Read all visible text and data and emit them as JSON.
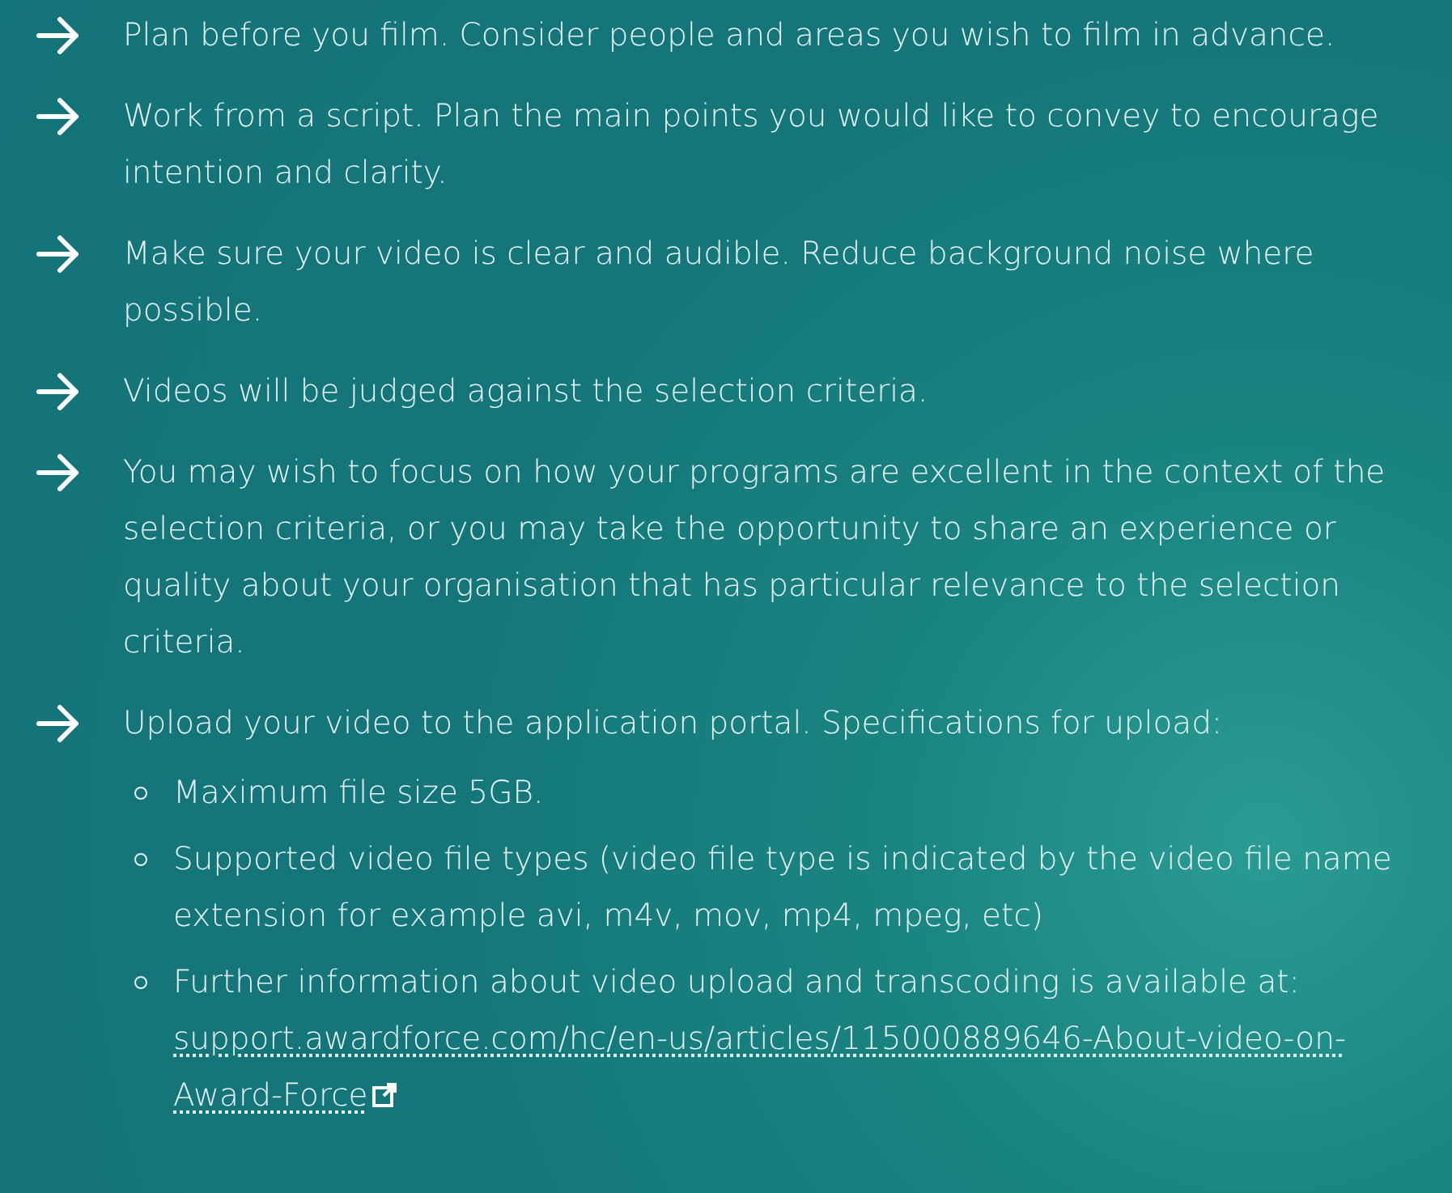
{
  "items": [
    {
      "text": "Plan before you film. Consider people and areas you wish to film in advance."
    },
    {
      "text": "Work from a script. Plan the main points you would like to convey to encourage intention and clarity."
    },
    {
      "text": "Make sure your video is clear and audible. Reduce background noise where possible."
    },
    {
      "text": "Videos will be judged against the selection criteria."
    },
    {
      "text": "You may wish to focus on how your programs are excellent in the context of the selection criteria, or you may take the opportunity to share an experience or quality about your organisation that has particular relevance to the selection criteria."
    },
    {
      "text": "Upload your video to the application portal. Specifications for upload:",
      "sub_items": [
        {
          "text": "Maximum file size 5GB."
        },
        {
          "text": "Supported video file types (video file type is indicated by the video file name extension for example avi, m4v, mov, mp4, mpeg, etc)"
        },
        {
          "text": "Further information about video upload and transcoding is available at:",
          "link": "support.awardforce.com/hc/en-us/articles/115000889646-About-video-on-Award-Force"
        }
      ]
    }
  ]
}
